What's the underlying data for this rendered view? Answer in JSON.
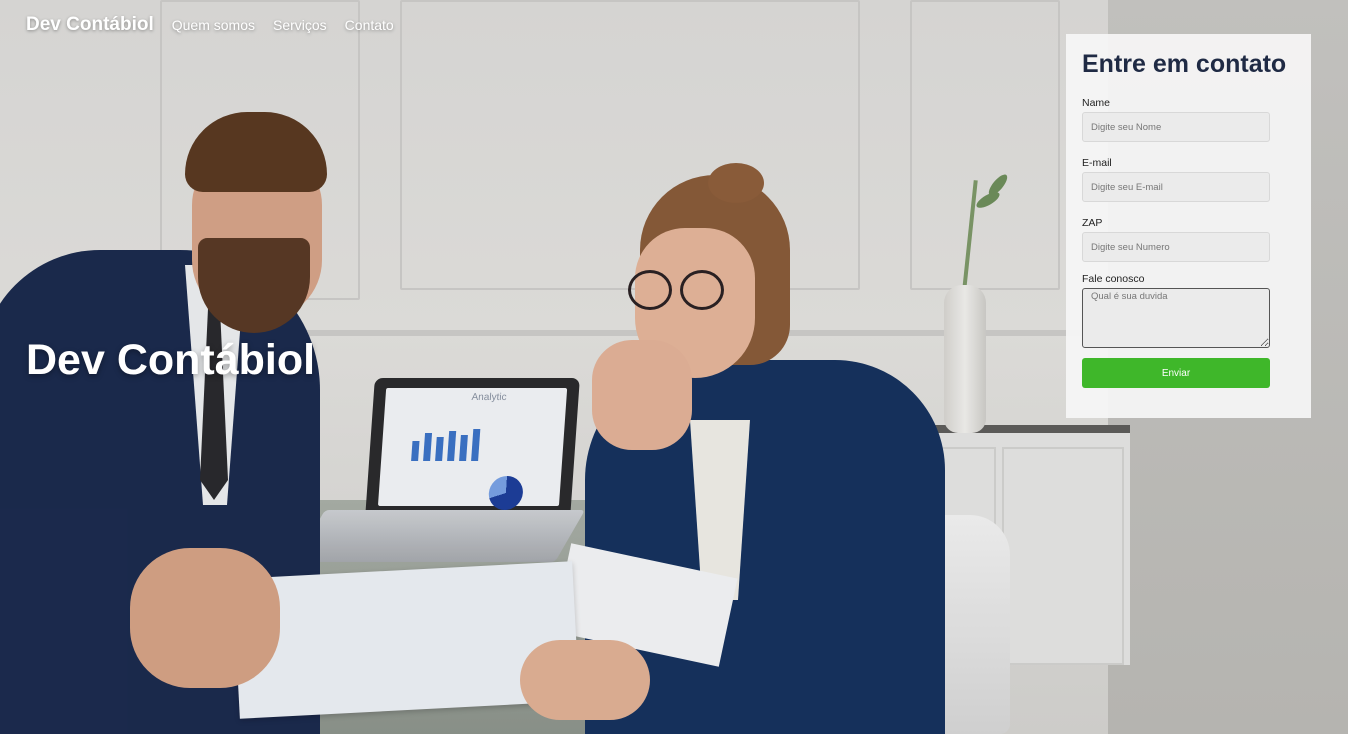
{
  "header": {
    "brand": "Dev Contábiol",
    "nav": [
      "Quem somos",
      "Serviços",
      "Contato"
    ]
  },
  "hero": {
    "title": "Dev Contábiol"
  },
  "contact_form": {
    "title": "Entre em contato",
    "fields": [
      {
        "label": "Name",
        "placeholder": "Digite seu Nome"
      },
      {
        "label": "E-mail",
        "placeholder": "Digite seu E-mail"
      },
      {
        "label": "ZAP",
        "placeholder": "Digite seu Numero"
      }
    ],
    "message": {
      "label": "Fale conosco",
      "placeholder": "Qual é sua duvida"
    },
    "submit_label": "Enviar"
  },
  "background": {
    "description_icon": "office-meeting-photo",
    "laptop_screen_title": "Analytic"
  },
  "colors": {
    "submit": "#3fb72a",
    "form_title": "#1f2a44"
  }
}
